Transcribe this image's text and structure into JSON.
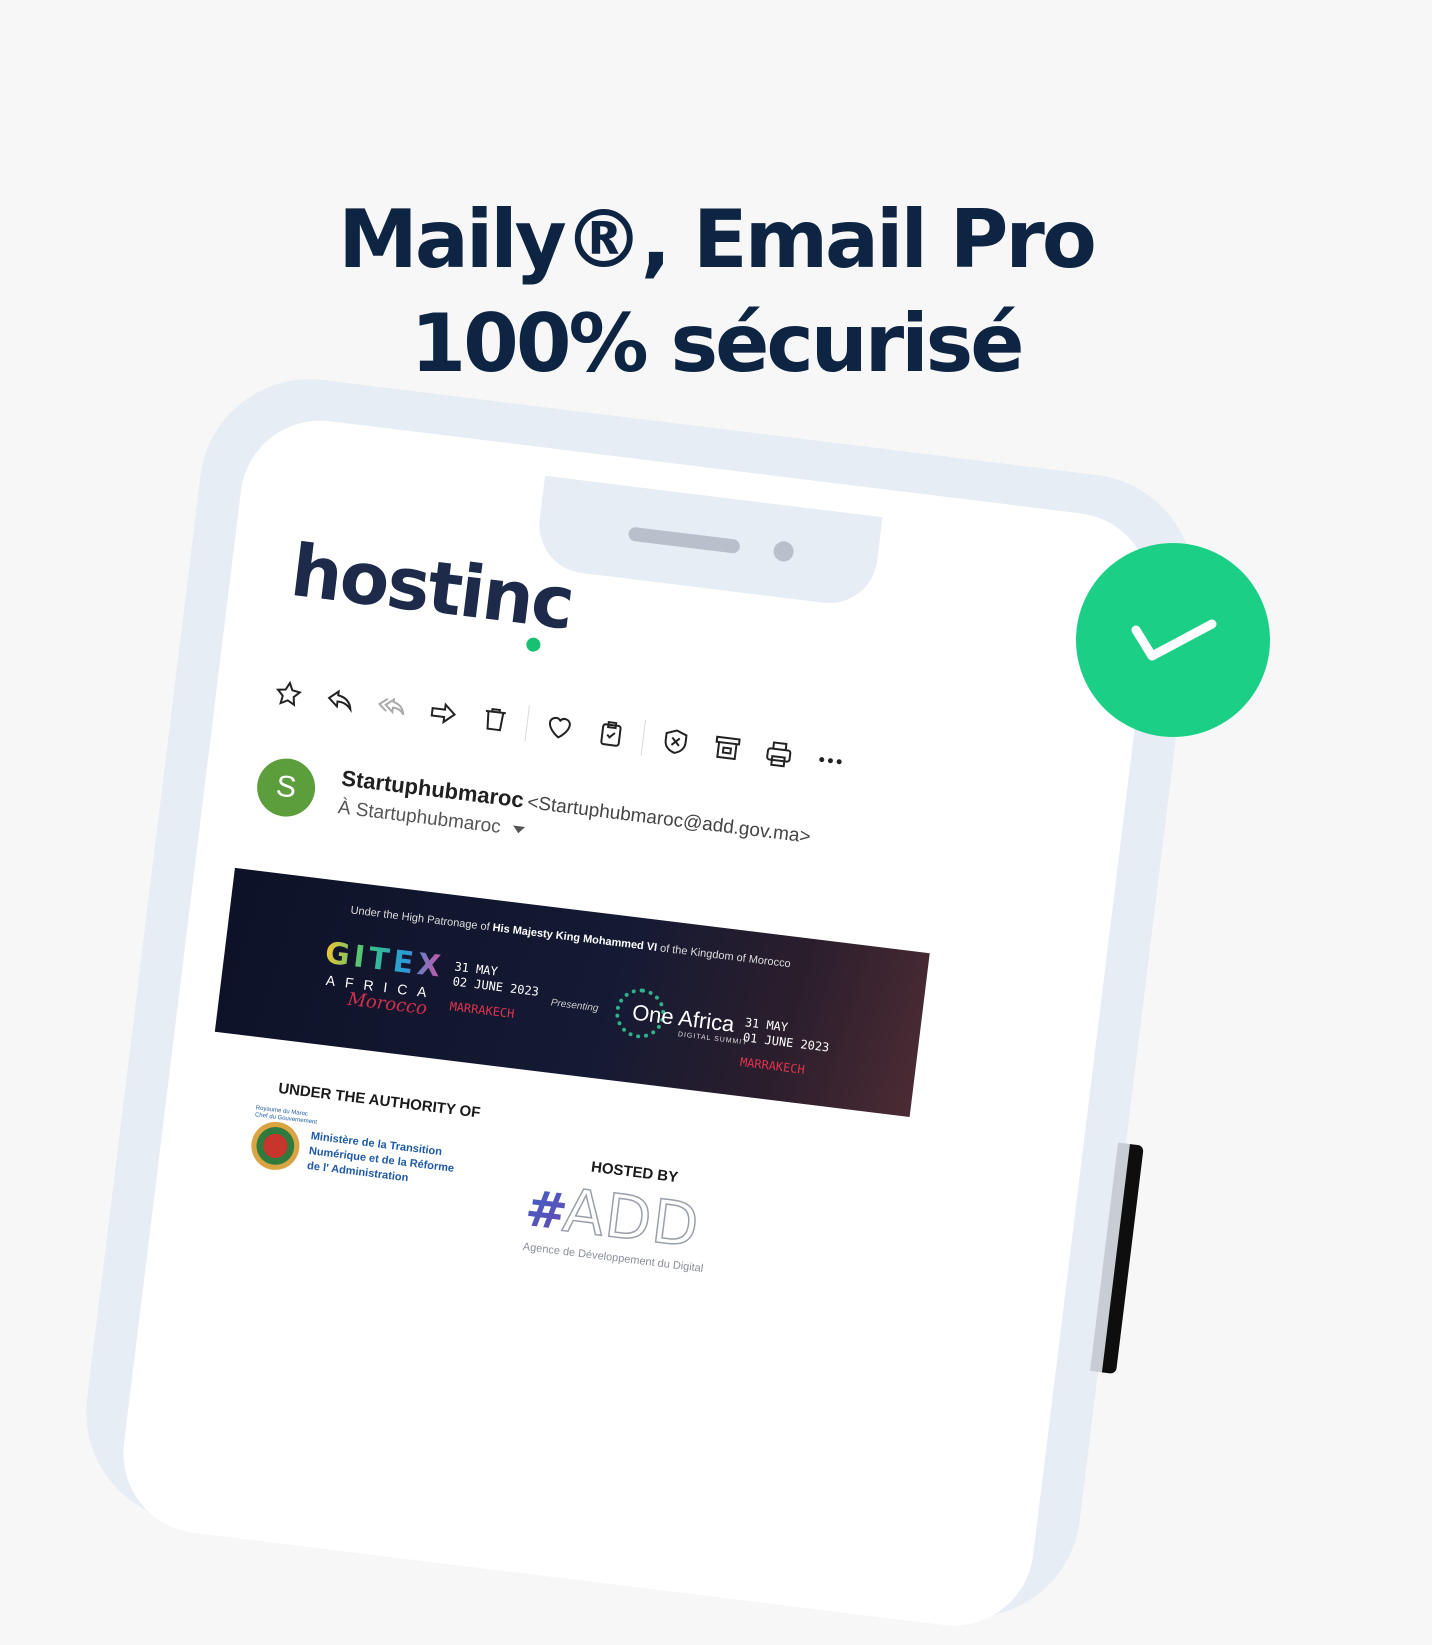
{
  "headline": {
    "line1": "Maily®, Email Pro",
    "line2": "100% sécurisé"
  },
  "logo": {
    "text": "hostinc"
  },
  "toolbar": {
    "icons": [
      "star-icon",
      "reply-icon",
      "reply-all-icon",
      "forward-icon",
      "trash-icon",
      "heart-icon",
      "clipboard-check-icon",
      "shield-x-icon",
      "archive-icon",
      "print-icon",
      "more-icon"
    ]
  },
  "email": {
    "avatar_letter": "S",
    "avatar_color": "#5c9e3b",
    "sender_name": "Startuphubmaroc",
    "sender_email": "<Startuphubmaroc@add.gov.ma>",
    "to": "À Startuphubmaroc"
  },
  "banner": {
    "patronage_pre": "Under the High Patronage of ",
    "patronage_bold": "His Majesty King Mohammed VI",
    "patronage_post": " of the Kingdom of Morocco",
    "gitex": "GITEX",
    "gitex_africa": "AFRICA",
    "gitex_morocco": "Morocco",
    "gitex_date1": "31 MAY",
    "gitex_date2": "02 JUNE 2023",
    "gitex_city": "MARRAKECH",
    "presenting": "Presenting",
    "oneafrica_title": "One Africa",
    "oneafrica_sub": "DIGITAL SUMMIT",
    "oneafrica_date1": "31 MAY",
    "oneafrica_date2": "01 JUNE 2023",
    "oneafrica_city": "MARRAKECH"
  },
  "footer": {
    "authority_label": "UNDER THE AUTHORITY OF",
    "gov_small1": "Royaume du Maroc",
    "gov_small2": "Chef du Gouvernement",
    "ministry_line1": "Ministère de la Transition",
    "ministry_line2": "Numérique et de la Réforme",
    "ministry_line3": "de l' Administration",
    "hosted_label": "HOSTED BY",
    "add_word": "ADD",
    "add_sub": "Agence de Développement du Digital"
  },
  "colors": {
    "headline": "#0d2443",
    "check_badge": "#1ccf86",
    "logo_accent": "#16c172"
  }
}
